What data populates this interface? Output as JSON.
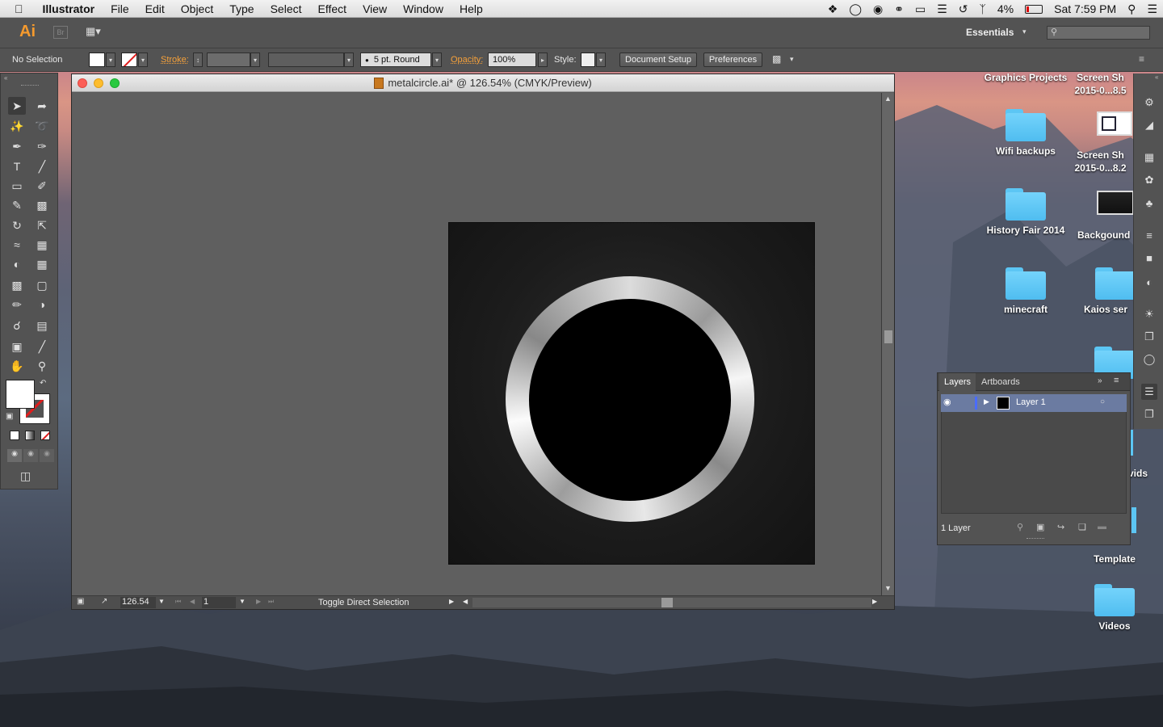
{
  "menubar": {
    "app_name": "Illustrator",
    "items": [
      "File",
      "Edit",
      "Object",
      "Type",
      "Select",
      "Effect",
      "View",
      "Window",
      "Help"
    ],
    "battery": "4%",
    "clock": "Sat 7:59 PM"
  },
  "appbar": {
    "logo": "Ai",
    "bridge_label": "Br",
    "workspace": "Essentials",
    "search_placeholder": ""
  },
  "control": {
    "selection": "No Selection",
    "stroke_label": "Stroke:",
    "brush": "5 pt. Round",
    "opacity_label": "Opacity:",
    "opacity_value": "100%",
    "style_label": "Style:",
    "document_setup": "Document Setup",
    "preferences": "Preferences"
  },
  "document": {
    "title": "metalcircle.ai* @ 126.54% (CMYK/Preview)",
    "zoom": "126.54",
    "artboard": "1",
    "status": "Toggle Direct Selection"
  },
  "desktop_icons": [
    {
      "label": "Graphics Projects",
      "kind": "text"
    },
    {
      "label": "Screen Sh 2015-0...8.5",
      "kind": "text"
    },
    {
      "label": "Wifi backups",
      "kind": "folder"
    },
    {
      "label": "Screen Sh 2015-0...8.2",
      "kind": "image"
    },
    {
      "label": "History Fair 2014",
      "kind": "folder"
    },
    {
      "label": "Backgound",
      "kind": "image"
    },
    {
      "label": "minecraft",
      "kind": "folder"
    },
    {
      "label": "Kaios ser",
      "kind": "folder"
    },
    {
      "label": "vids",
      "kind": "folder"
    },
    {
      "label": "Template",
      "kind": "folder"
    },
    {
      "label": "Videos",
      "kind": "folder"
    }
  ],
  "layers_panel": {
    "tabs": [
      "Layers",
      "Artboards"
    ],
    "layer_name": "Layer 1",
    "count": "1 Layer"
  },
  "colors": {
    "folder": "#5cc6f4",
    "orange_label": "#f6a13a",
    "panel": "#535353",
    "layer_selected": "#6b7ba1"
  }
}
